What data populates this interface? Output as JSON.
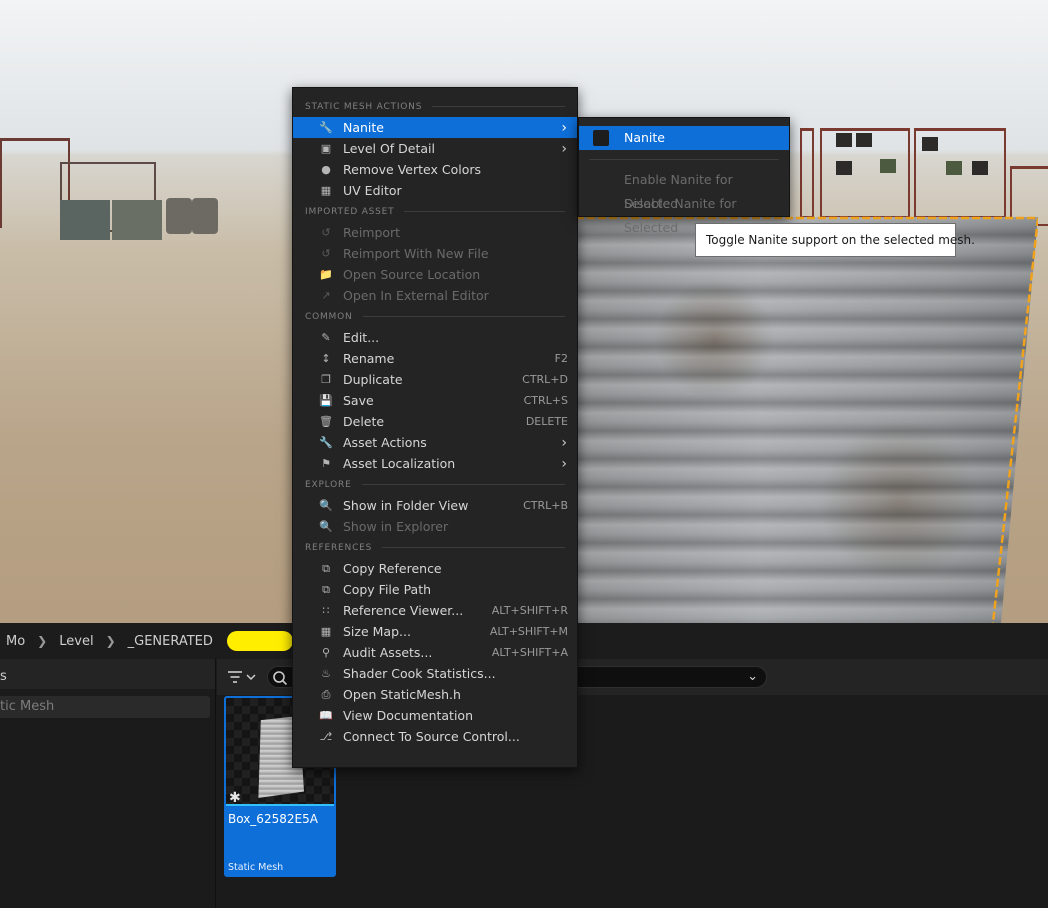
{
  "context_menu": {
    "sections": {
      "static_mesh_actions": "STATIC MESH ACTIONS",
      "imported_asset": "IMPORTED ASSET",
      "common": "COMMON",
      "explore": "EXPLORE",
      "references": "REFERENCES"
    },
    "items": {
      "nanite": {
        "label": "Nanite"
      },
      "level_of_detail": {
        "label": "Level Of Detail"
      },
      "remove_vertex_colors": {
        "label": "Remove Vertex Colors"
      },
      "uv_editor": {
        "label": "UV Editor"
      },
      "reimport": {
        "label": "Reimport"
      },
      "reimport_new_file": {
        "label": "Reimport With New File"
      },
      "open_source_location": {
        "label": "Open Source Location"
      },
      "open_external_editor": {
        "label": "Open In External Editor"
      },
      "edit": {
        "label": "Edit..."
      },
      "rename": {
        "label": "Rename",
        "shortcut": "F2"
      },
      "duplicate": {
        "label": "Duplicate",
        "shortcut": "CTRL+D"
      },
      "save": {
        "label": "Save",
        "shortcut": "CTRL+S"
      },
      "delete": {
        "label": "Delete",
        "shortcut": "DELETE"
      },
      "asset_actions": {
        "label": "Asset Actions"
      },
      "asset_localization": {
        "label": "Asset Localization"
      },
      "show_in_folder_view": {
        "label": "Show in Folder View",
        "shortcut": "CTRL+B"
      },
      "show_in_explorer": {
        "label": "Show in Explorer"
      },
      "copy_reference": {
        "label": "Copy Reference"
      },
      "copy_file_path": {
        "label": "Copy File Path"
      },
      "reference_viewer": {
        "label": "Reference Viewer...",
        "shortcut": "ALT+SHIFT+R"
      },
      "size_map": {
        "label": "Size Map...",
        "shortcut": "ALT+SHIFT+M"
      },
      "audit_assets": {
        "label": "Audit Assets...",
        "shortcut": "ALT+SHIFT+A"
      },
      "shader_cook_statistics": {
        "label": "Shader Cook Statistics..."
      },
      "open_header": {
        "label": "Open StaticMesh.h"
      },
      "view_documentation": {
        "label": "View Documentation"
      },
      "connect_source_control": {
        "label": "Connect To Source Control..."
      }
    }
  },
  "submenu": {
    "nanite_toggle": "Nanite",
    "enable": "Enable Nanite for Selected",
    "disable": "Disable Nanite for Selected"
  },
  "tooltip": "Toggle Nanite support on the selected mesh.",
  "breadcrumb": [
    "Mo",
    "Level",
    "_GENERATED"
  ],
  "left_panel": {
    "header": "s",
    "filter": "tic Mesh"
  },
  "asset": {
    "name": "Box_62582E5A",
    "type": "Static Mesh"
  },
  "colors": {
    "highlight": "#0e6fd9",
    "menu_bg": "#242424",
    "selection_outline": "#f0a21c"
  }
}
